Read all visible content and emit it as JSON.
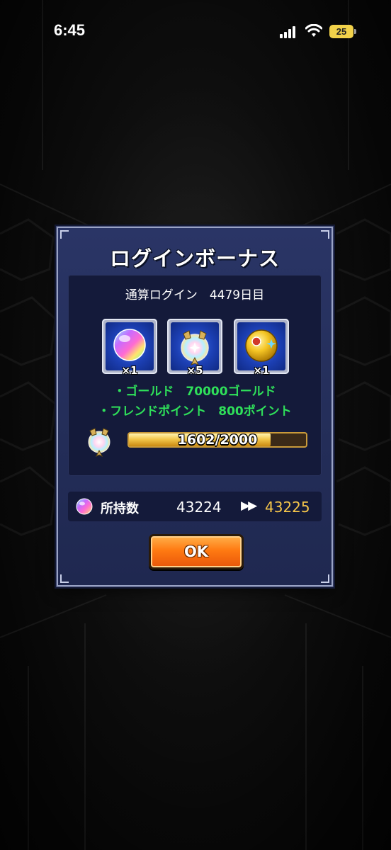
{
  "status_bar": {
    "time": "6:45",
    "battery": "25",
    "icons": [
      "signal-icon",
      "wifi-icon",
      "battery-icon"
    ]
  },
  "dialog": {
    "title": "ログインボーナス",
    "login_count": "通算ログイン　4479日目",
    "rewards": [
      {
        "icon": "rainbow-orb-icon",
        "count": "×1"
      },
      {
        "icon": "friend-medal-icon",
        "count": "×5"
      },
      {
        "icon": "gold-orb-icon",
        "count": "×1"
      }
    ],
    "bonus_lines": [
      "・ゴールド　70000ゴールド",
      "・フレンドポイント　800ポイント"
    ],
    "progress": {
      "text": "1602/2000",
      "current": 1602,
      "max": 2000
    },
    "owned": {
      "label": "所持数",
      "before": "43224",
      "arrows": "▶▶",
      "after": "43225"
    },
    "ok_label": "OK"
  },
  "colors": {
    "dialog_bg": "#232d58",
    "panel_bg": "#141a3a",
    "bonus_text": "#2fe05a",
    "highlight_value": "#f6c64a",
    "ok_button": "#ff7a12"
  }
}
